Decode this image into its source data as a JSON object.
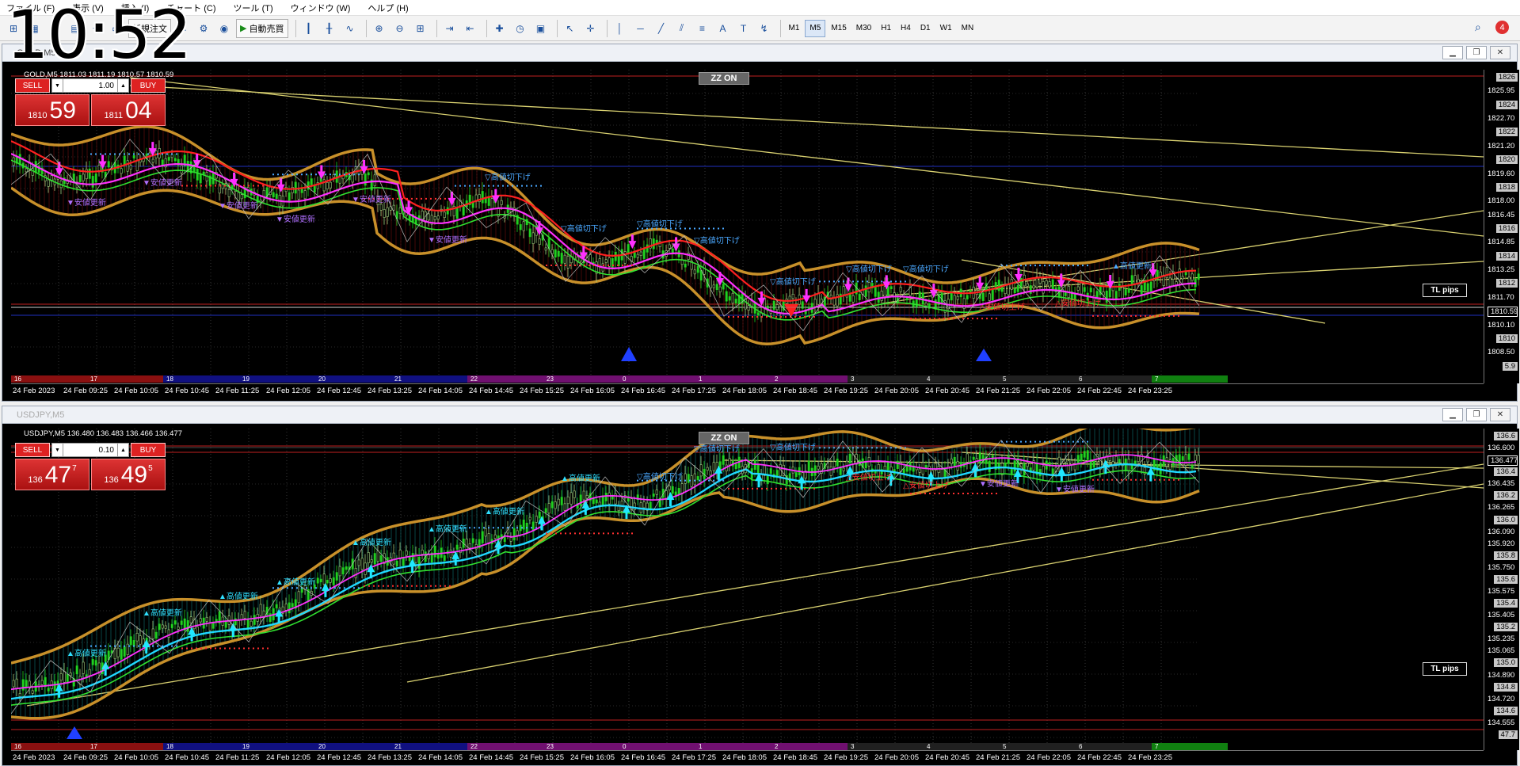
{
  "clock": "10:52",
  "menu": [
    "ファイル (F)",
    "表示 (V)",
    "挿入 (I)",
    "チャート (C)",
    "ツール (T)",
    "ウィンドウ (W)",
    "ヘルプ (H)"
  ],
  "toolbar": {
    "new_order": "新規注文",
    "auto_trade": "自動売買",
    "timeframes": [
      "M1",
      "M5",
      "M15",
      "M30",
      "H1",
      "H4",
      "D1",
      "W1",
      "MN"
    ],
    "active_timeframe": "M5",
    "notifications": "4"
  },
  "charts": [
    {
      "window_title": "GOLD,M5",
      "symbol_line": "GOLD,M5 1811.03 1811.19 1810.57 1810.59",
      "zz_label": "ZZ ON",
      "tl_pips": "TL pips",
      "trade": {
        "sell": "SELL",
        "buy": "BUY",
        "lot": "1.00",
        "sell_small": "1810",
        "sell_big": "59",
        "sell_sup": "",
        "buy_small": "1811",
        "buy_big": "04",
        "buy_sup": ""
      },
      "price_axis": [
        "1826",
        "1825.95",
        "1824",
        "1822.70",
        "1822",
        "1821.20",
        "1820",
        "1819.60",
        "1818",
        "1818.00",
        "1816.45",
        "1816",
        "1814.85",
        "1814",
        "1813.25",
        "1812",
        "1811.70",
        "1810.59",
        "1810.10",
        "1810",
        "1808.50",
        "5.9"
      ],
      "time_axis": [
        "24 Feb 2023",
        "24 Feb 09:25",
        "24 Feb 10:05",
        "24 Feb 10:45",
        "24 Feb 11:25",
        "24 Feb 12:05",
        "24 Feb 12:45",
        "24 Feb 13:25",
        "24 Feb 14:05",
        "24 Feb 14:45",
        "24 Feb 15:25",
        "24 Feb 16:05",
        "24 Feb 16:45",
        "24 Feb 17:25",
        "24 Feb 18:05",
        "24 Feb 18:45",
        "24 Feb 19:25",
        "24 Feb 20:05",
        "24 Feb 20:45",
        "24 Feb 21:25",
        "24 Feb 22:05",
        "24 Feb 22:45",
        "24 Feb 23:25"
      ],
      "session_numbers": [
        "16",
        "17",
        "18",
        "19",
        "20",
        "21",
        "22",
        "23",
        "0",
        "1",
        "2",
        "3",
        "4",
        "5",
        "6",
        "7"
      ],
      "annotations": [
        {
          "t": "▼安値更新",
          "c": "#b070ff"
        },
        {
          "t": "▼安値更新",
          "c": "#b070ff"
        },
        {
          "t": "▼安値更新",
          "c": "#b070ff"
        },
        {
          "t": "▼安値更新",
          "c": "#b070ff"
        },
        {
          "t": "▼安値更新",
          "c": "#b070ff"
        },
        {
          "t": "▼安値更新",
          "c": "#b070ff"
        },
        {
          "t": "▽高値切下げ",
          "c": "#4aa8ff"
        },
        {
          "t": "▽高値切下げ",
          "c": "#4aa8ff"
        },
        {
          "t": "▽高値切下げ",
          "c": "#4aa8ff"
        },
        {
          "t": "▽高値切下げ",
          "c": "#4aa8ff"
        },
        {
          "t": "▽高値切下げ",
          "c": "#4aa8ff"
        },
        {
          "t": "▽高値切下げ",
          "c": "#4aa8ff"
        },
        {
          "t": "▽高値切下げ",
          "c": "#4aa8ff"
        },
        {
          "t": "△安値切上げ",
          "c": "#ff3030"
        },
        {
          "t": "△安値切上げ",
          "c": "#ff3030"
        },
        {
          "t": "▲高値更新",
          "c": "#4aa8ff"
        }
      ]
    },
    {
      "window_title": "USDJPY,M5",
      "symbol_line": "USDJPY,M5 136.480 136.483 136.466 136.477",
      "zz_label": "ZZ ON",
      "tl_pips": "TL pips",
      "trade": {
        "sell": "SELL",
        "buy": "BUY",
        "lot": "0.10",
        "sell_small": "136",
        "sell_big": "47",
        "sell_sup": "7",
        "buy_small": "136",
        "buy_big": "49",
        "buy_sup": "5"
      },
      "price_axis": [
        "136.6",
        "136.600",
        "136.477",
        "136.4",
        "136.435",
        "136.2",
        "136.265",
        "136.0",
        "136.090",
        "135.920",
        "135.8",
        "135.750",
        "135.6",
        "135.575",
        "135.4",
        "135.405",
        "135.2",
        "135.235",
        "135.065",
        "135.0",
        "134.890",
        "134.8",
        "134.720",
        "134.6",
        "134.555",
        "47.7"
      ],
      "time_axis": [
        "24 Feb 2023",
        "24 Feb 09:25",
        "24 Feb 10:05",
        "24 Feb 10:45",
        "24 Feb 11:25",
        "24 Feb 12:05",
        "24 Feb 12:45",
        "24 Feb 13:25",
        "24 Feb 14:05",
        "24 Feb 14:45",
        "24 Feb 15:25",
        "24 Feb 16:05",
        "24 Feb 16:45",
        "24 Feb 17:25",
        "24 Feb 18:05",
        "24 Feb 18:45",
        "24 Feb 19:25",
        "24 Feb 20:05",
        "24 Feb 20:45",
        "24 Feb 21:25",
        "24 Feb 22:05",
        "24 Feb 22:45",
        "24 Feb 23:25"
      ],
      "session_numbers": [
        "16",
        "17",
        "18",
        "19",
        "20",
        "21",
        "22",
        "23",
        "0",
        "1",
        "2",
        "3",
        "4",
        "5",
        "6",
        "7"
      ],
      "annotations": [
        {
          "t": "▲高値更新",
          "c": "#30e0ff"
        },
        {
          "t": "▲高値更新",
          "c": "#30e0ff"
        },
        {
          "t": "▲高値更新",
          "c": "#30e0ff"
        },
        {
          "t": "▲高値更新",
          "c": "#30e0ff"
        },
        {
          "t": "▲高値更新",
          "c": "#30e0ff"
        },
        {
          "t": "▲高値更新",
          "c": "#30e0ff"
        },
        {
          "t": "▲高値更新",
          "c": "#30e0ff"
        },
        {
          "t": "▲高値更新",
          "c": "#30e0ff"
        },
        {
          "t": "▽高値切下げ",
          "c": "#4aa8ff"
        },
        {
          "t": "▽高値切下げ",
          "c": "#4aa8ff"
        },
        {
          "t": "▽高値切下げ",
          "c": "#4aa8ff"
        },
        {
          "t": "△安値切上げ",
          "c": "#ff3030"
        },
        {
          "t": "△安値切上げ",
          "c": "#ff3030"
        },
        {
          "t": "▼安値更新",
          "c": "#b070ff"
        },
        {
          "t": "▼安値更新",
          "c": "#b070ff"
        }
      ]
    }
  ],
  "colors": {
    "bull": "#20d020",
    "bear": "#a0d080",
    "band": "#c8902a",
    "ma_fast": "#ff2020",
    "ma_mid": "#ff30ff",
    "ma_slow": "#30e030",
    "ma_cyan": "#20d8ff",
    "trendline": "#d8d070",
    "arrow_down": "#ff30ff",
    "arrow_up": "#20e8ff"
  }
}
